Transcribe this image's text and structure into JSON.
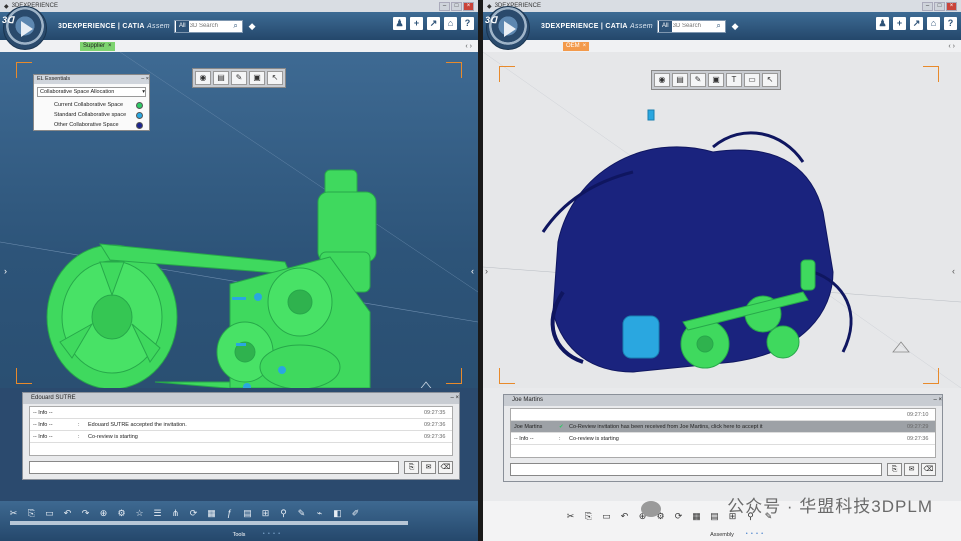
{
  "left_window": {
    "title": "3DEXPERIENCE",
    "app_name_prefix": "3DEXPERIENCE | ",
    "app_name_brand": "CATIA",
    "app_name_suffix": "Assem",
    "search_scope": "All",
    "search_placeholder": "3D Search",
    "tab_label": "Supplier",
    "essentials_title": "EL Essentials",
    "essentials_dropdown": "Collaborative Space Allocation",
    "legend": [
      {
        "label": "Current Collaborative Space",
        "color": "#2ec965"
      },
      {
        "label": "Standard Collaborative space",
        "color": "#2aa7e0"
      },
      {
        "label": "Other Collaborative Space",
        "color": "#1c2590"
      }
    ],
    "chat_title": "Edouard SUTRE",
    "chat_messages": [
      {
        "who": "-- Info --",
        "txt": "",
        "time": "09:27:35"
      },
      {
        "who": "-- Info --",
        "txt": "Edouard SUTRE accepted the invitation.",
        "time": "09:27:36"
      },
      {
        "who": "-- Info --",
        "txt": "Co-review is starting",
        "time": "09:27:36"
      }
    ],
    "bottom_label": "Tools",
    "part_color": "#3fd95e"
  },
  "right_window": {
    "title": "3DEXPERIENCE",
    "app_name_prefix": "3DEXPERIENCE | ",
    "app_name_brand": "CATIA",
    "app_name_suffix": "Assem",
    "search_scope": "All",
    "search_placeholder": "3D Search",
    "tab_label": "OEM",
    "chat_title": "Joe Martins",
    "chat_messages": [
      {
        "who": "",
        "txt": "",
        "time": "09:27:10"
      },
      {
        "who": "Joe Martins",
        "txt": "Co-Review invitation has been received from Joe Martins, click here to accept it",
        "time": "09:27:29"
      },
      {
        "who": "-- Info --",
        "txt": "Co-review is starting",
        "time": "09:27:36"
      }
    ],
    "bottom_label": "Assembly",
    "engine_color": "#1a237e",
    "accent_color": "#2aa7e0"
  },
  "watermark": "公众号 · 华盟科技3DPLM",
  "icons": {
    "top_right": [
      "user-icon",
      "plus-icon",
      "share-icon",
      "home-icon",
      "help-icon"
    ],
    "float_toolbar_left": [
      "camera-icon",
      "trash-icon",
      "pen-icon",
      "select-icon",
      "cursor-icon"
    ],
    "float_toolbar_right": [
      "camera-icon",
      "trash-icon",
      "pen-icon",
      "select-icon",
      "text-icon",
      "window-icon",
      "cursor-icon"
    ]
  }
}
